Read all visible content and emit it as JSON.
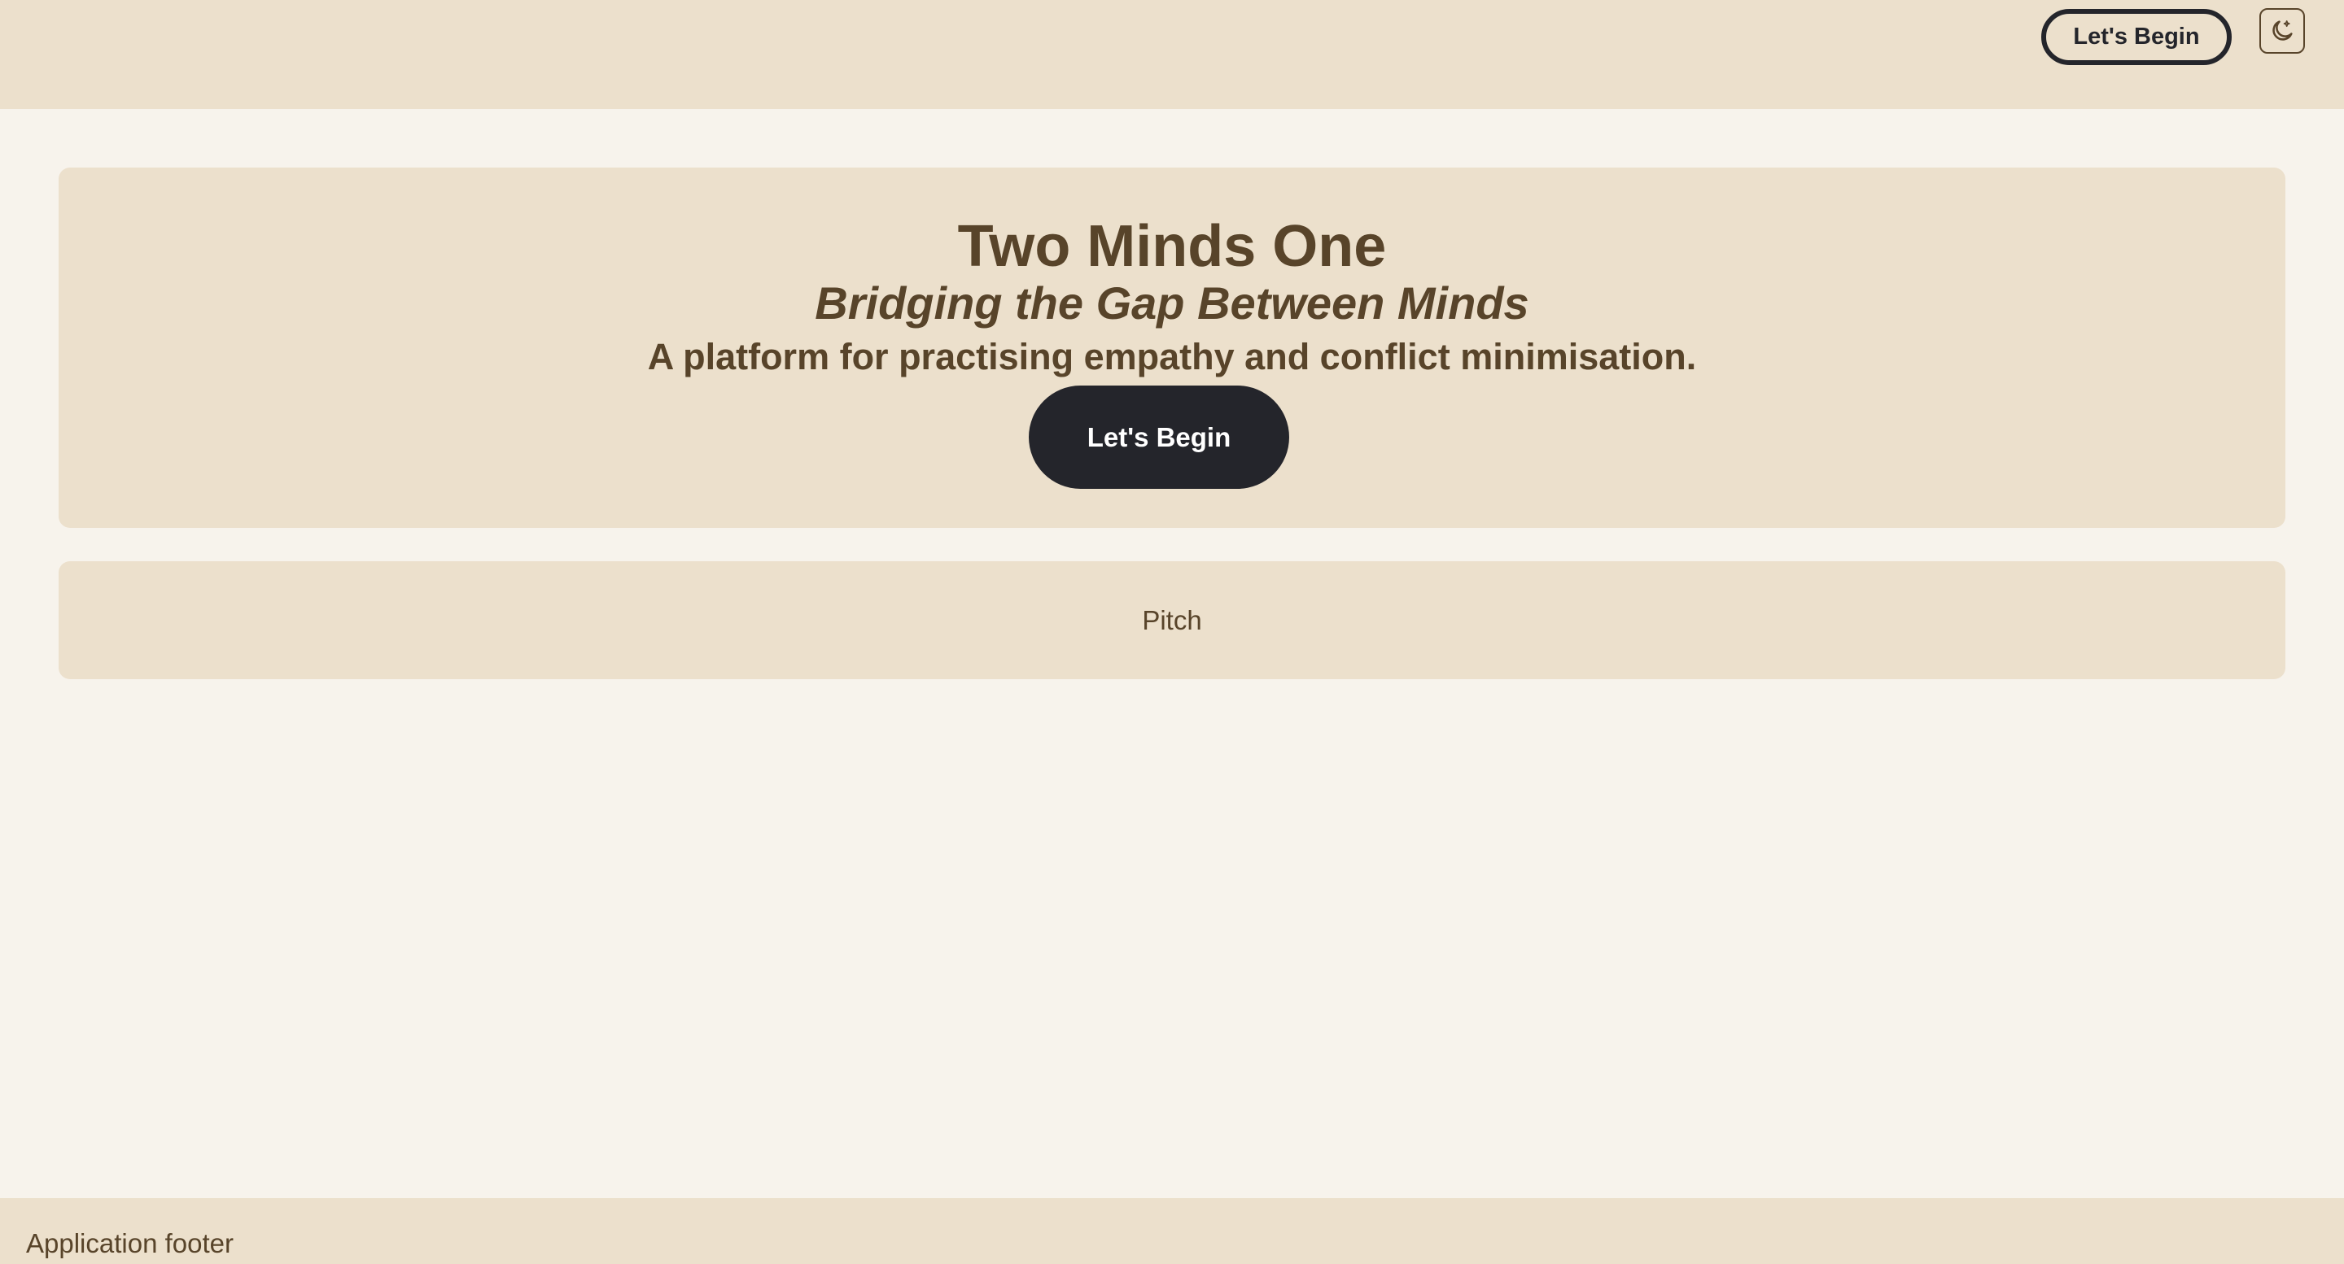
{
  "topbar": {
    "cta_label": "Let's Begin",
    "theme_toggle_icon": "moon-icon"
  },
  "hero": {
    "title": "Two Minds One",
    "subtitle": "Bridging the Gap Between Minds",
    "tagline": "A platform for practising empathy and conflict minimisation.",
    "cta_label": "Let's Begin"
  },
  "pitch": {
    "label": "Pitch"
  },
  "footer": {
    "text": "Application footer"
  },
  "colors": {
    "background": "#f7f3ec",
    "panel": "#ece0cc",
    "text": "#58442a",
    "button_dark": "#24252b"
  }
}
